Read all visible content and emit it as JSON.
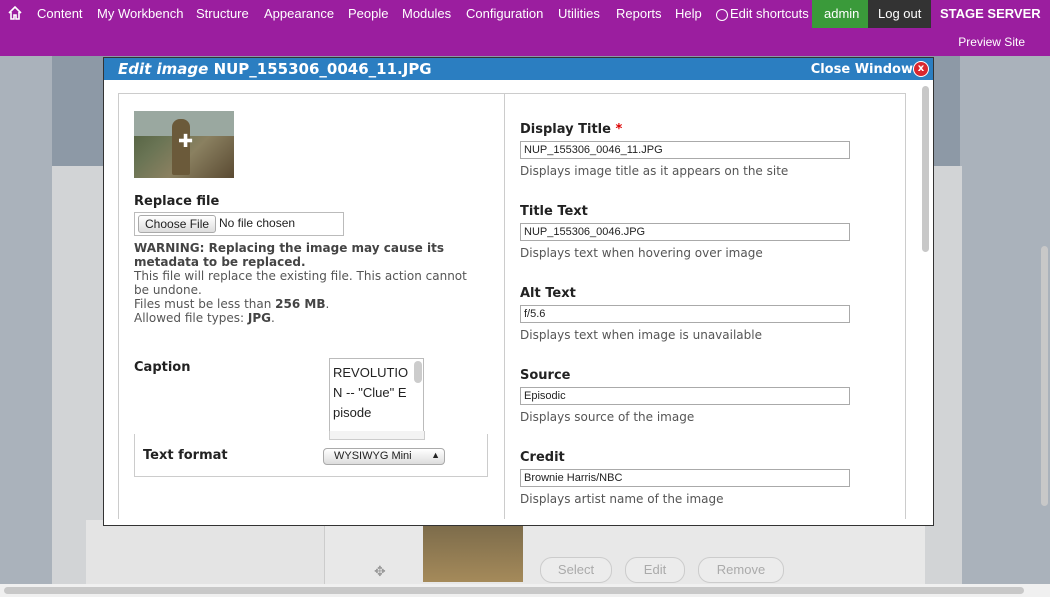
{
  "topbar": {
    "items": [
      "Content",
      "My Workbench",
      "Structure",
      "Appearance",
      "People",
      "Modules",
      "Configuration",
      "Utilities",
      "Reports",
      "Help"
    ],
    "shortcuts": "Edit shortcuts",
    "admin": "admin",
    "logout": "Log out",
    "server": "STAGE SERVER",
    "preview": "Preview Site"
  },
  "dialog": {
    "title_prefix": "Edit image",
    "title_file": "NUP_155306_0046_11.JPG",
    "close": "Close Window",
    "close_x": "x"
  },
  "left": {
    "replace_label": "Replace file",
    "choose_button": "Choose File",
    "no_file": "No file chosen",
    "warning_bold": "WARNING: Replacing the image may cause its metadata to be replaced.",
    "warning_line": "This file will replace the existing file. This action cannot be undone.",
    "size_prefix": "Files must be less than ",
    "size_value": "256 MB",
    "size_suffix": ".",
    "types_prefix": "Allowed file types: ",
    "types_value": "JPG",
    "types_suffix": ".",
    "caption_label": "Caption",
    "caption_value": "REVOLUTION -- \"Clue\" Episode",
    "text_format_label": "Text format",
    "text_format_value": "WYSIWYG Mini"
  },
  "right": {
    "display_title_label": "Display Title",
    "required_mark": "*",
    "display_title_value": "NUP_155306_0046_11.JPG",
    "display_title_desc": "Displays image title as it appears on the site",
    "title_text_label": "Title Text",
    "title_text_value": "NUP_155306_0046.JPG",
    "title_text_desc": "Displays text when hovering over image",
    "alt_text_label": "Alt Text",
    "alt_text_value": "f/5.6",
    "alt_text_desc": "Displays text when image is unavailable",
    "source_label": "Source",
    "source_value": "Episodic",
    "source_desc": "Displays source of the image",
    "credit_label": "Credit",
    "credit_value": "Brownie Harris/NBC",
    "credit_desc": "Displays artist name of the image"
  },
  "background": {
    "select": "Select",
    "edit": "Edit",
    "remove": "Remove"
  }
}
